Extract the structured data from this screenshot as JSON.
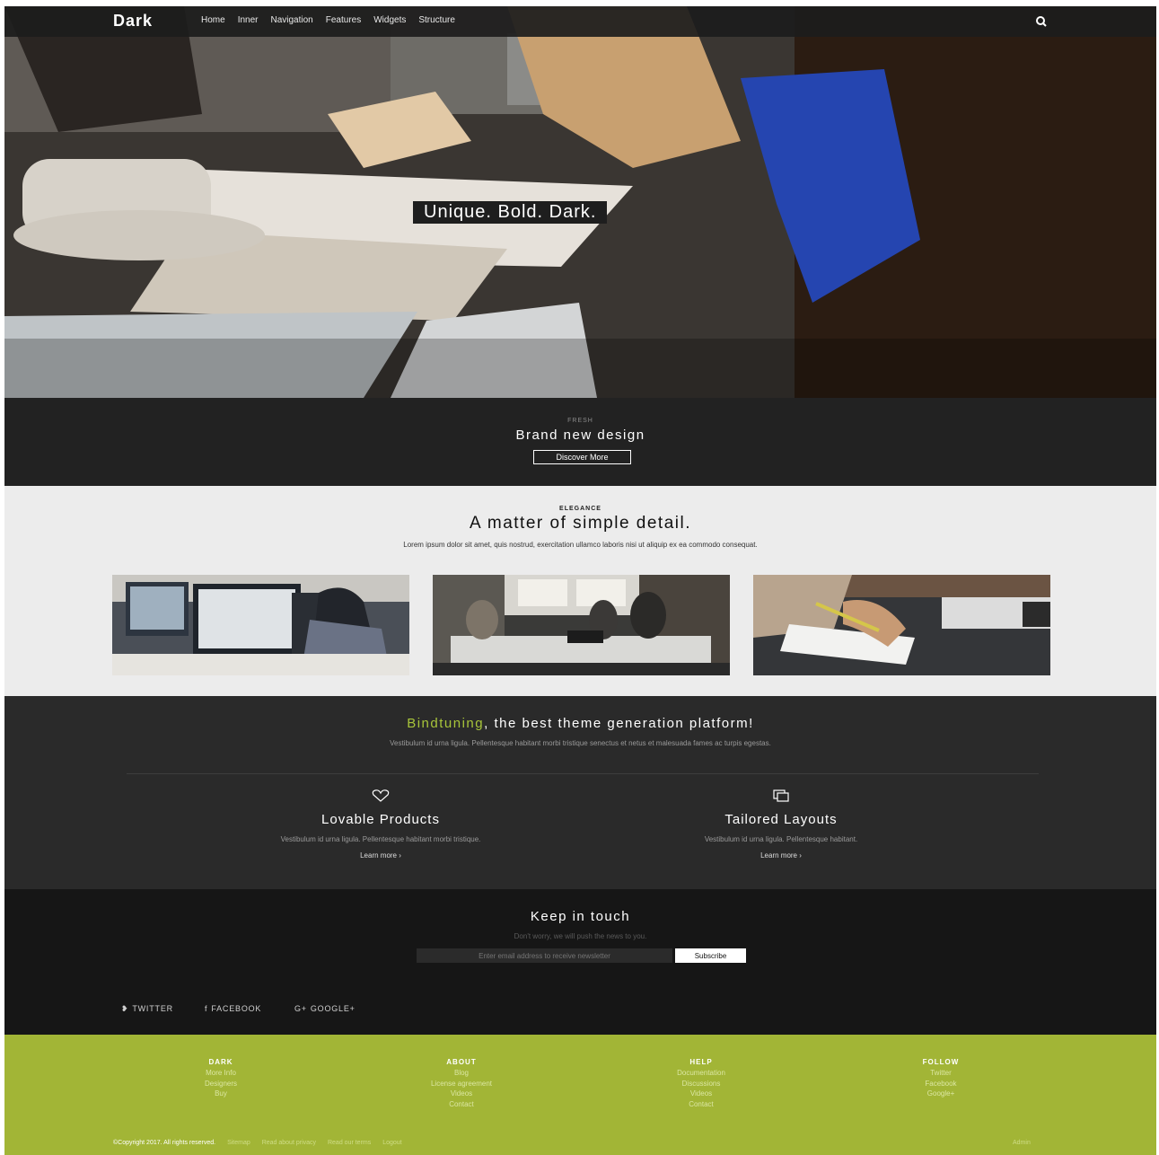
{
  "nav": {
    "logo": "Dark",
    "items": [
      "Home",
      "Inner",
      "Navigation",
      "Features",
      "Widgets",
      "Structure"
    ],
    "search_icon": "search-icon"
  },
  "hero": {
    "title": "Unique. Bold. Dark."
  },
  "fresh": {
    "eyebrow": "FRESH",
    "heading": "Brand new design",
    "button": "Discover More"
  },
  "elegance": {
    "eyebrow": "ELEGANCE",
    "heading": "A matter of simple detail.",
    "sub": "Lorem ipsum dolor sit amet, quis nostrud, exercitation ullamco laboris nisi ut aliquip ex ea commodo consequat."
  },
  "platform": {
    "heading_accent": "Bindtuning",
    "heading_rest": ", the best theme generation platform!",
    "sub": "Vestibulum id urna ligula. Pellentesque habitant morbi tristique senectus et netus et malesuada fames ac turpis egestas.",
    "features": [
      {
        "icon": "heart-icon",
        "title": "Lovable Products",
        "desc": "Vestibulum id urna ligula. Pellentesque habitant morbi tristique.",
        "link": "Learn more  ›"
      },
      {
        "icon": "layers-icon",
        "title": "Tailored Layouts",
        "desc": "Vestibulum id urna ligula. Pellentesque habitant.",
        "link": "Learn more  ›"
      }
    ]
  },
  "touch": {
    "heading": "Keep in touch",
    "sub": "Don't worry, we will push the news to you.",
    "email_placeholder": "Enter email address to receive newsletter",
    "subscribe": "Subscribe",
    "social": [
      "TWITTER",
      "FACEBOOK",
      "GOOGLE+"
    ]
  },
  "footer": {
    "columns": [
      {
        "head": "DARK",
        "items": [
          "More Info",
          "Designers",
          "Buy"
        ]
      },
      {
        "head": "ABOUT",
        "items": [
          "Blog",
          "License agreement",
          "Videos",
          "Contact"
        ]
      },
      {
        "head": "HELP",
        "items": [
          "Documentation",
          "Discussions",
          "Videos",
          "Contact"
        ]
      },
      {
        "head": "FOLLOW",
        "items": [
          "Twitter",
          "Facebook",
          "Google+"
        ]
      }
    ],
    "copyright": "©Copyright 2017. All rights reserved.",
    "links": [
      "Sitemap",
      "Read about privacy",
      "Read our terms",
      "Logout"
    ],
    "admin": "Admin"
  },
  "colors": {
    "accent": "#a8c53a",
    "footer": "#a2b536",
    "dark": "#222222"
  }
}
